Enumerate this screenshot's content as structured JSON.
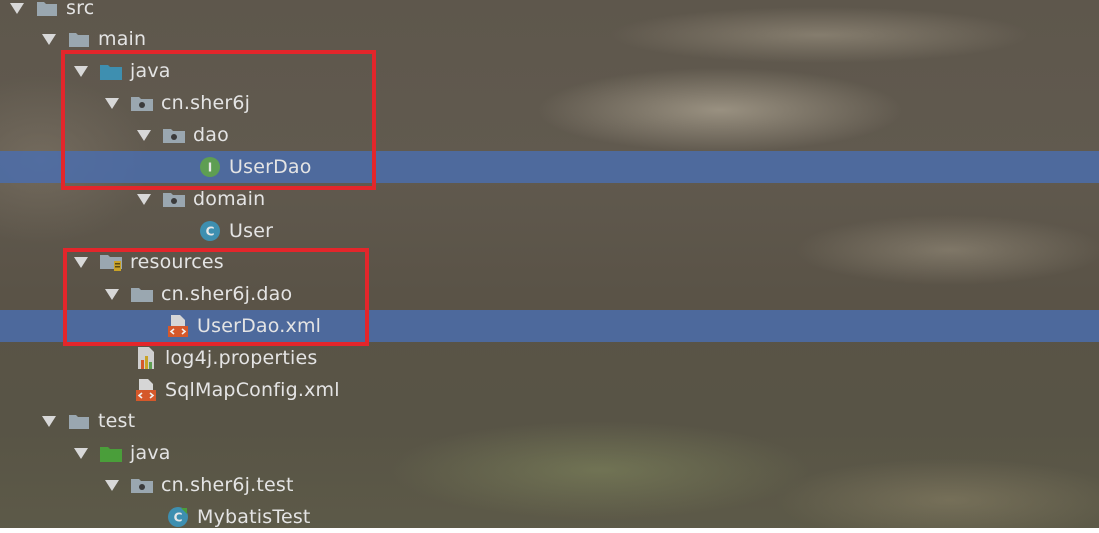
{
  "project_tree": {
    "nodes": [
      {
        "label": "src",
        "kind": "folder",
        "expanded": true
      },
      {
        "label": "main",
        "kind": "folder",
        "expanded": true
      },
      {
        "label": "java",
        "kind": "source-folder",
        "expanded": true
      },
      {
        "label": "cn.sher6j",
        "kind": "package",
        "expanded": true
      },
      {
        "label": "dao",
        "kind": "package",
        "expanded": true
      },
      {
        "label": "UserDao",
        "kind": "interface",
        "selected": true
      },
      {
        "label": "domain",
        "kind": "package",
        "expanded": true
      },
      {
        "label": "User",
        "kind": "class"
      },
      {
        "label": "resources",
        "kind": "resources-folder",
        "expanded": true
      },
      {
        "label": "cn.sher6j.dao",
        "kind": "folder",
        "expanded": true
      },
      {
        "label": "UserDao.xml",
        "kind": "xml-file",
        "selected": true
      },
      {
        "label": "log4j.properties",
        "kind": "properties-file"
      },
      {
        "label": "SqlMapConfig.xml",
        "kind": "xml-file"
      },
      {
        "label": "test",
        "kind": "folder",
        "expanded": true
      },
      {
        "label": "java",
        "kind": "test-source-folder",
        "expanded": true
      },
      {
        "label": "cn.sher6j.test",
        "kind": "package",
        "expanded": true
      },
      {
        "label": "MybatisTest",
        "kind": "test-class"
      }
    ],
    "icon_letters": {
      "interface": "I",
      "class": "C"
    },
    "colors": {
      "selection": "#4b6eaf",
      "highlight_box": "#e3262b",
      "text": "#e4e4e4",
      "folder": "#9aa7b0",
      "source_folder": "#3e8fb0",
      "test_folder": "#4a9e3a",
      "interface_badge": "#5e9e52",
      "class_badge": "#3e8fb0"
    }
  }
}
